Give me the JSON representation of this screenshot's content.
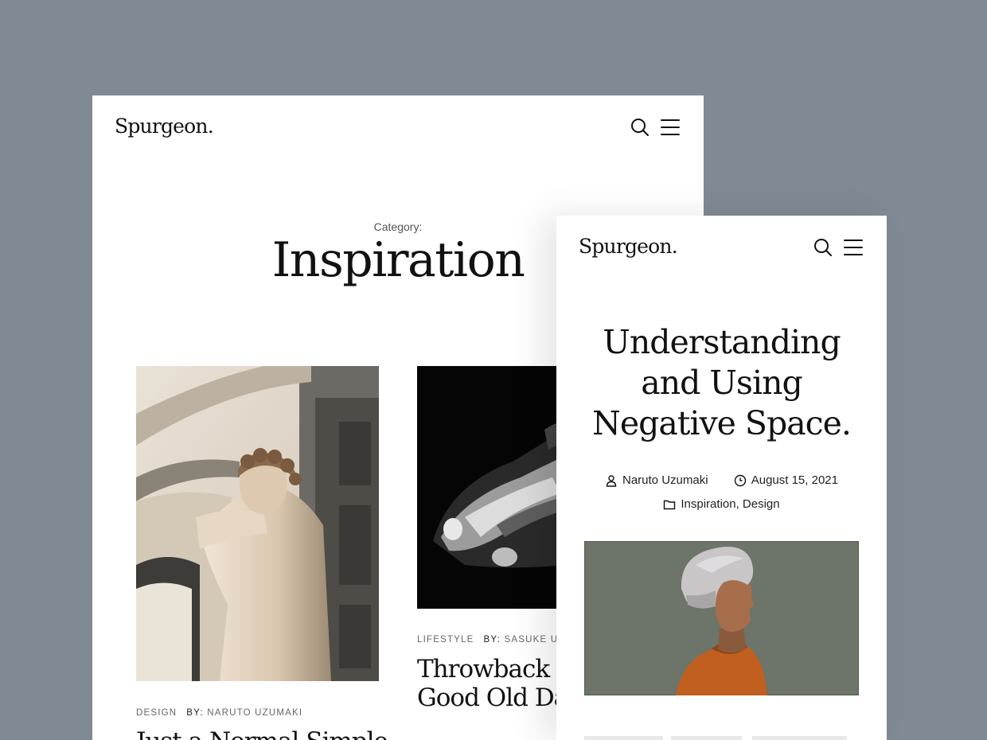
{
  "category_page": {
    "logo": "Spurgeon.",
    "category_label": "Category:",
    "category_title": "Inspiration",
    "posts": [
      {
        "category": "DESIGN",
        "by_label": "BY:",
        "author": "NARUTO UZUMAKI",
        "title": "Just a Normal Simple"
      },
      {
        "category": "LIFESTYLE",
        "by_label": "BY:",
        "author": "SASUKE UC",
        "title_line1": "Throwback T",
        "title_line2": "Good Old Da"
      }
    ]
  },
  "article_page": {
    "logo": "Spurgeon.",
    "title_line1": "Understanding",
    "title_line2": "and Using",
    "title_line3": "Negative Space.",
    "author": "Naruto Uzumaki",
    "date": "August 15, 2021",
    "categories": "Inspiration, Design"
  },
  "icons": {
    "search": "search-icon",
    "menu": "menu-icon",
    "user": "user-icon",
    "clock": "clock-icon",
    "folder": "folder-icon"
  },
  "colors": {
    "background": "#808a94",
    "card": "#ffffff",
    "text": "#111111",
    "muted": "#666666"
  }
}
